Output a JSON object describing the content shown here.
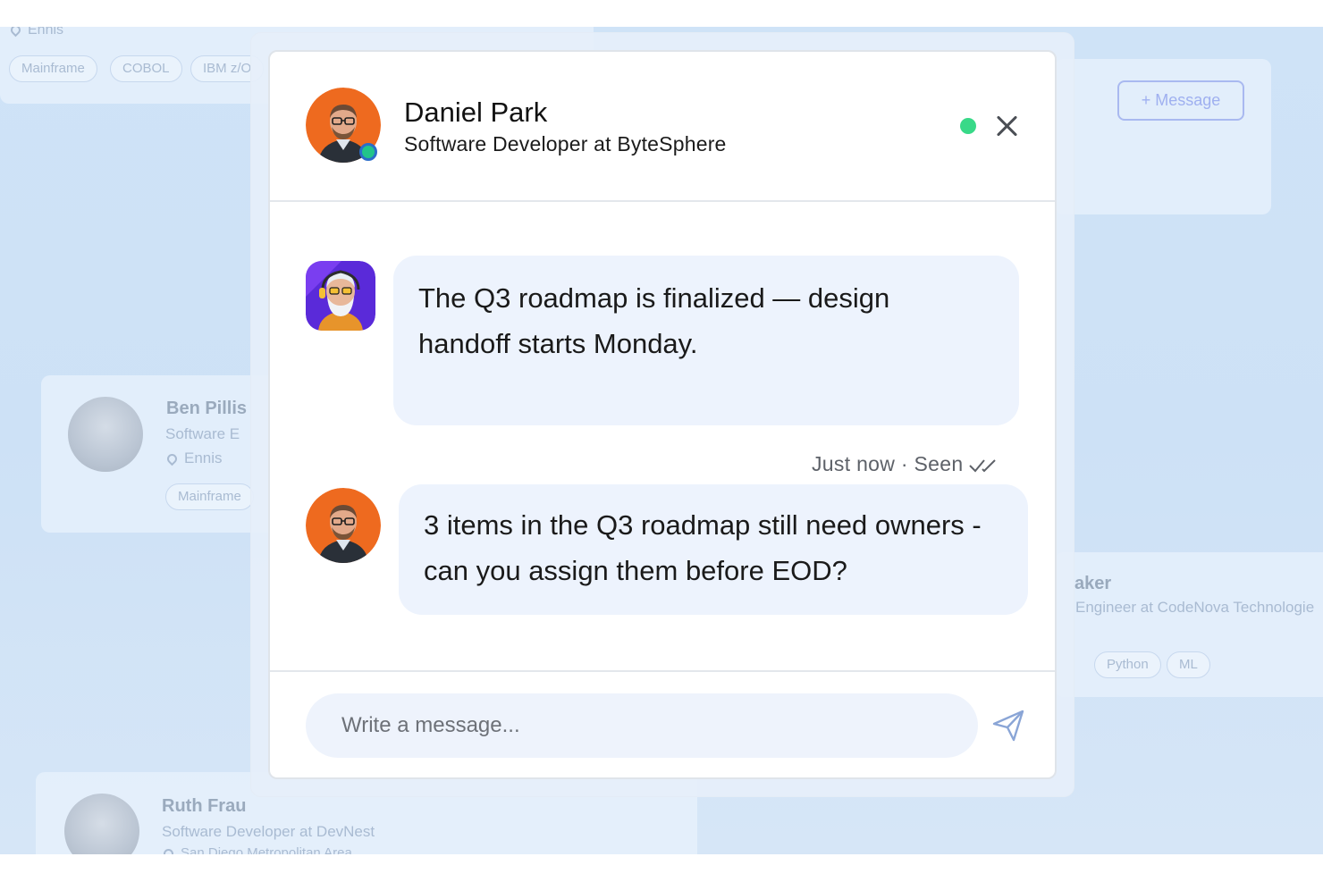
{
  "background": {
    "top_card": {
      "location": "Ennis",
      "tags": [
        "Mainframe",
        "COBOL",
        "IBM z/O"
      ]
    },
    "right_card": {
      "message_button": "+ Message"
    },
    "left_card": {
      "name": "Ben Pillis",
      "title": "Software E",
      "location": "Ennis",
      "tag": "Mainframe"
    },
    "right_lower_card": {
      "name": "aker",
      "title": "Engineer at CodeNova Technologie",
      "tags": [
        "Python",
        "ML"
      ]
    },
    "bottom_card": {
      "name": "Ruth Frau",
      "title": "Software Developer at DevNest",
      "location": "San Diego Metropolitan Area"
    }
  },
  "chat": {
    "contact": {
      "name": "Daniel Park",
      "title": "Software Developer at ByteSphere",
      "online": true
    },
    "messages": [
      {
        "sender": "bot",
        "text": "The Q3 roadmap is finalized — design handoff starts Monday."
      },
      {
        "sender": "Daniel Park",
        "text": "3 items in the Q3 roadmap still need owners - can you assign them before EOD?",
        "status": "Just now · Seen"
      }
    ],
    "composer": {
      "placeholder": "Write a message..."
    }
  },
  "colors": {
    "accent": "#38d988",
    "bubble": "#edf3fd",
    "avatar_orange": "#ee6a1f",
    "bot_purple": "#5a2ad9"
  },
  "icons": [
    "close-icon",
    "send-icon",
    "double-check-icon",
    "location-pin-icon"
  ]
}
